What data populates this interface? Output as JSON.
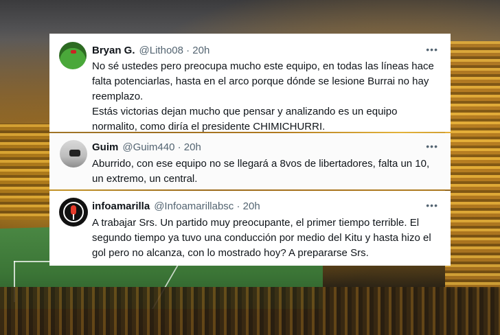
{
  "tweets": [
    {
      "name": "Bryan G.",
      "meta": "@Litho08 · 20h",
      "more": "•••",
      "lines": [
        "No sé ustedes pero preocupa mucho este equipo, en todas las líneas hace falta potenciarlas, hasta en el arco porque dónde se lesione Burrai no hay reemplazo.",
        "Estás victorias dejan mucho que pensar y analizando es un equipo normalito, como diría el presidente CHIMICHURRI."
      ]
    },
    {
      "name": "Guim",
      "meta": "@Guim440 · 20h",
      "more": "•••",
      "lines": [
        "Aburrido, con ese equipo no se llegará a 8vos de libertadores, falta un 10, un extremo, un central."
      ]
    },
    {
      "name": "infoamarilla",
      "meta": "@Infoamarillabsc · 20h",
      "more": "•••",
      "lines": [
        "A trabajar Srs. Un partido muy preocupante, el primer tiempo terrible. El segundo tiempo ya tuvo una conducción por medio del Kitu y hasta hizo el gol pero no alcanza, con lo mostrado hoy? A prepararse Srs."
      ]
    }
  ]
}
